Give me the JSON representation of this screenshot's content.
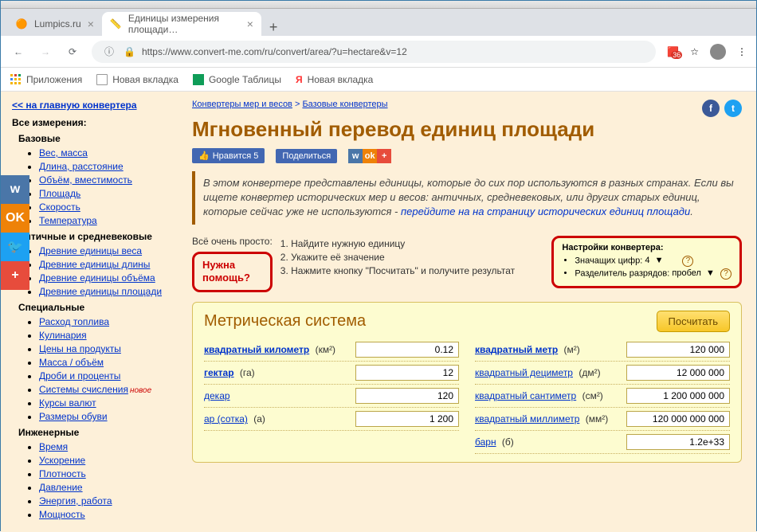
{
  "browser": {
    "tabs": [
      {
        "title": "Lumpics.ru",
        "active": false
      },
      {
        "title": "Единицы измерения площади…",
        "active": true
      }
    ],
    "url": "https://www.convert-me.com/ru/convert/area/?u=hectare&v=12",
    "ext_badge": "36",
    "bookmarks": {
      "apps": "Приложения",
      "b1": "Новая вкладка",
      "b2": "Google Таблицы",
      "b3": "Новая вкладка"
    }
  },
  "sidebar": {
    "back": "<< на главную конвертера",
    "all_h": "Все измерения:",
    "g1": "Базовые",
    "g1_items": [
      "Вес, масса",
      "Длина, расстояние",
      "Объём, вместимость",
      "Площадь",
      "Скорость",
      "Температура"
    ],
    "g2": "Античные и средневековые",
    "g2_items": [
      "Древние единицы веса",
      "Древние единицы длины",
      "Древние единицы объёма",
      "Древние единицы площади"
    ],
    "g3": "Специальные",
    "g3_items": [
      "Расход топлива",
      "Кулинария",
      "Цены на продукты",
      "Масса / объём",
      "Дроби и проценты",
      "Системы счисления",
      "Курсы валют",
      "Размеры обуви"
    ],
    "new_tag": "новое",
    "g4": "Инженерные",
    "g4_items": [
      "Время",
      "Ускорение",
      "Плотность",
      "Давление",
      "Энергия, работа",
      "Мощность"
    ]
  },
  "main": {
    "breadcrumb": {
      "a": "Конвертеры мер и весов",
      "sep": " > ",
      "b": "Базовые конвертеры"
    },
    "h1": "Мгновенный перевод единиц площади",
    "fb_like": "Нравится 5",
    "fb_share": "Поделиться",
    "intro": "В этом конвертере представлены единицы, которые до сих пор используются в разных странах. Если вы ищете конвертер исторических мер и весов: античных, средневековых, или других старых единиц, которые сейчас уже не используются - ",
    "intro_link": "перейдите на на страницу исторических единиц площади",
    "help_title": "Всё очень просто:",
    "help_box_l1": "Нужна",
    "help_box_l2": "помощь?",
    "steps": {
      "s1": "1. Найдите нужную единицу",
      "s2": "2. Укажите её значение",
      "s3": "3. Нажмите кнопку \"Посчитать\" и получите результат"
    },
    "settings": {
      "title": "Настройки конвертера:",
      "opt1_label": "Значащих цифр:",
      "opt1_value": "4",
      "opt2_label": "Разделитель разрядов:",
      "opt2_value": "пробел"
    }
  },
  "conv": {
    "title": "Метрическая система",
    "button": "Посчитать",
    "left": [
      {
        "label": "квадратный километр",
        "unit": "(км²)",
        "value": "0.12",
        "bold": true
      },
      {
        "label": "гектар",
        "unit": "(га)",
        "value": "12",
        "bold": true
      },
      {
        "label": "декар",
        "unit": "",
        "value": "120",
        "bold": false
      },
      {
        "label": "ар (сотка)",
        "unit": "(а)",
        "value": "1 200",
        "bold": false
      }
    ],
    "right": [
      {
        "label": "квадратный метр",
        "unit": "(м²)",
        "value": "120 000",
        "bold": true
      },
      {
        "label": "квадратный дециметр",
        "unit": "(дм²)",
        "value": "12 000 000",
        "bold": false
      },
      {
        "label": "квадратный сантиметр",
        "unit": "(см²)",
        "value": "1 200 000 000",
        "bold": false
      },
      {
        "label": "квадратный миллиметр",
        "unit": "(мм²)",
        "value": "120 000 000 000",
        "bold": false
      },
      {
        "label": "барн",
        "unit": "(б)",
        "value": "1.2e+33",
        "bold": false
      }
    ]
  }
}
